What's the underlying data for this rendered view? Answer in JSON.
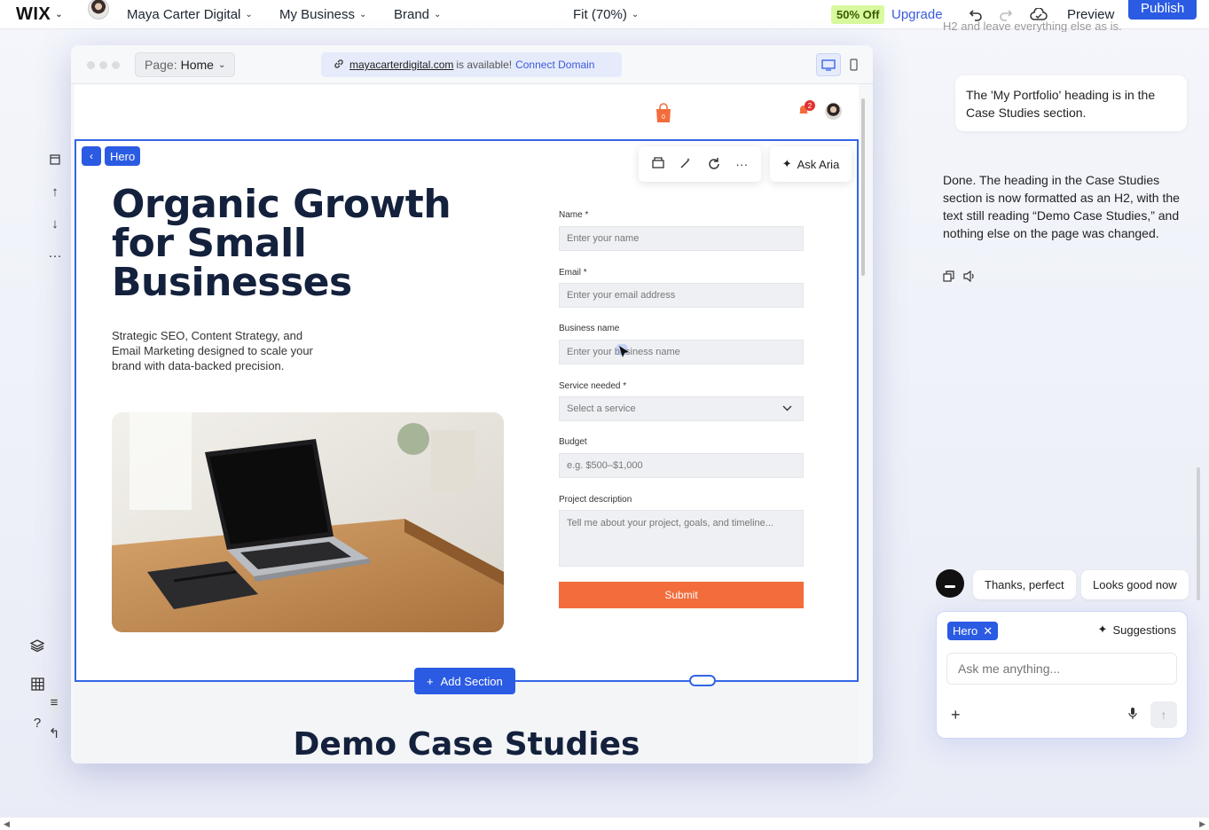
{
  "topbar": {
    "logo": "WIX",
    "site_name": "Maya Carter Digital",
    "menu_business": "My Business",
    "menu_brand": "Brand",
    "zoom": "Fit (70%)",
    "sale_badge": "50% Off",
    "upgrade": "Upgrade",
    "preview": "Preview",
    "publish": "Publish"
  },
  "editor": {
    "page_prefix": "Page:",
    "page_name": "Home",
    "domain": "mayacarterdigital.com",
    "domain_status": "is available!",
    "connect_domain": "Connect Domain"
  },
  "site": {
    "cart_count": "0",
    "notification_count": "2",
    "section_tag": "Hero",
    "ask_aria": "Ask Aria",
    "hero_title": "Organic Growth for Small Businesses",
    "hero_subtitle": "Strategic SEO, Content Strategy, and Email Marketing designed to scale your brand with data-backed precision.",
    "form": {
      "name_label": "Name *",
      "name_placeholder": "Enter your name",
      "email_label": "Email *",
      "email_placeholder": "Enter your email address",
      "business_label": "Business name",
      "business_placeholder": "Enter your business name",
      "service_label": "Service needed *",
      "service_placeholder": "Select a service",
      "budget_label": "Budget",
      "budget_placeholder": "e.g. $500–$1,000",
      "description_label": "Project description",
      "description_placeholder": "Tell me about your project, goals, and timeline...",
      "submit": "Submit"
    },
    "add_section": "Add Section",
    "next_section_title": "Demo Case Studies"
  },
  "chat": {
    "cut_off_text": "H2 and leave everything else as is.",
    "user_message": "The 'My Portfolio' heading is in the Case Studies section.",
    "ai_reply": "Done. The heading in the Case Studies section is now formatted as an H2, with the text still reading “Demo Case Studies,” and nothing else on the page was changed.",
    "quick_replies": [
      "Thanks, perfect",
      "Looks good now"
    ],
    "context_chip": "Hero",
    "suggestions": "Suggestions",
    "input_placeholder": "Ask me anything..."
  },
  "colors": {
    "accent": "#2b5be3",
    "submit": "#f26d3b",
    "heading": "#14213d",
    "sale": "#d9f99d"
  }
}
